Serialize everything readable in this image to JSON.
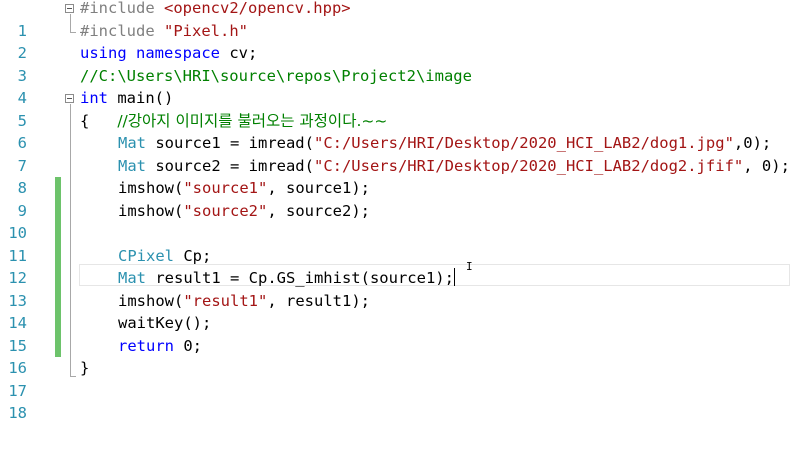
{
  "editor": {
    "line_numbers": [
      "1",
      "2",
      "3",
      "4",
      "5",
      "6",
      "7",
      "8",
      "9",
      "10",
      "11",
      "12",
      "13",
      "14",
      "15",
      "16",
      "17",
      "18"
    ],
    "lines": {
      "l1": {
        "a": "#include ",
        "b": "<opencv2/opencv.hpp>"
      },
      "l2": {
        "a": "#include ",
        "b": "\"Pixel.h\""
      },
      "l3": {
        "a": "using",
        "b": " ",
        "c": "namespace",
        "d": " cv;"
      },
      "l4": {
        "a": "//C:\\Users\\HRI\\source\\repos\\Project2\\image"
      },
      "l5": {
        "a": "int",
        "b": " main()"
      },
      "l6": {
        "a": "{   ",
        "b": "//강아지 이미지를 불러오는 과정이다.~~"
      },
      "l7": {
        "a": "Mat",
        "b": " source1 = imread(",
        "c": "\"C:/Users/HRI/Desktop/2020_HCI_LAB2/dog1.jpg\"",
        "d": ",0);"
      },
      "l8": {
        "a": "Mat",
        "b": " source2 = imread(",
        "c": "\"C:/Users/HRI/Desktop/2020_HCI_LAB2/dog2.jfif\"",
        "d": ", 0);"
      },
      "l9": {
        "a": "imshow(",
        "b": "\"source1\"",
        "c": ", source1);"
      },
      "l10": {
        "a": "imshow(",
        "b": "\"source2\"",
        "c": ", source2);"
      },
      "l12": {
        "a": "CPixel",
        "b": " Cp;"
      },
      "l13": {
        "a": "Mat",
        "b": " result1 = Cp.GS_imhist(source1);"
      },
      "l14": {
        "a": "imshow(",
        "b": "\"result1\"",
        "c": ", result1);"
      },
      "l15": {
        "a": "waitKey();"
      },
      "l16": {
        "a": "return",
        "b": " 0;"
      },
      "l17": {
        "a": "}"
      }
    }
  }
}
